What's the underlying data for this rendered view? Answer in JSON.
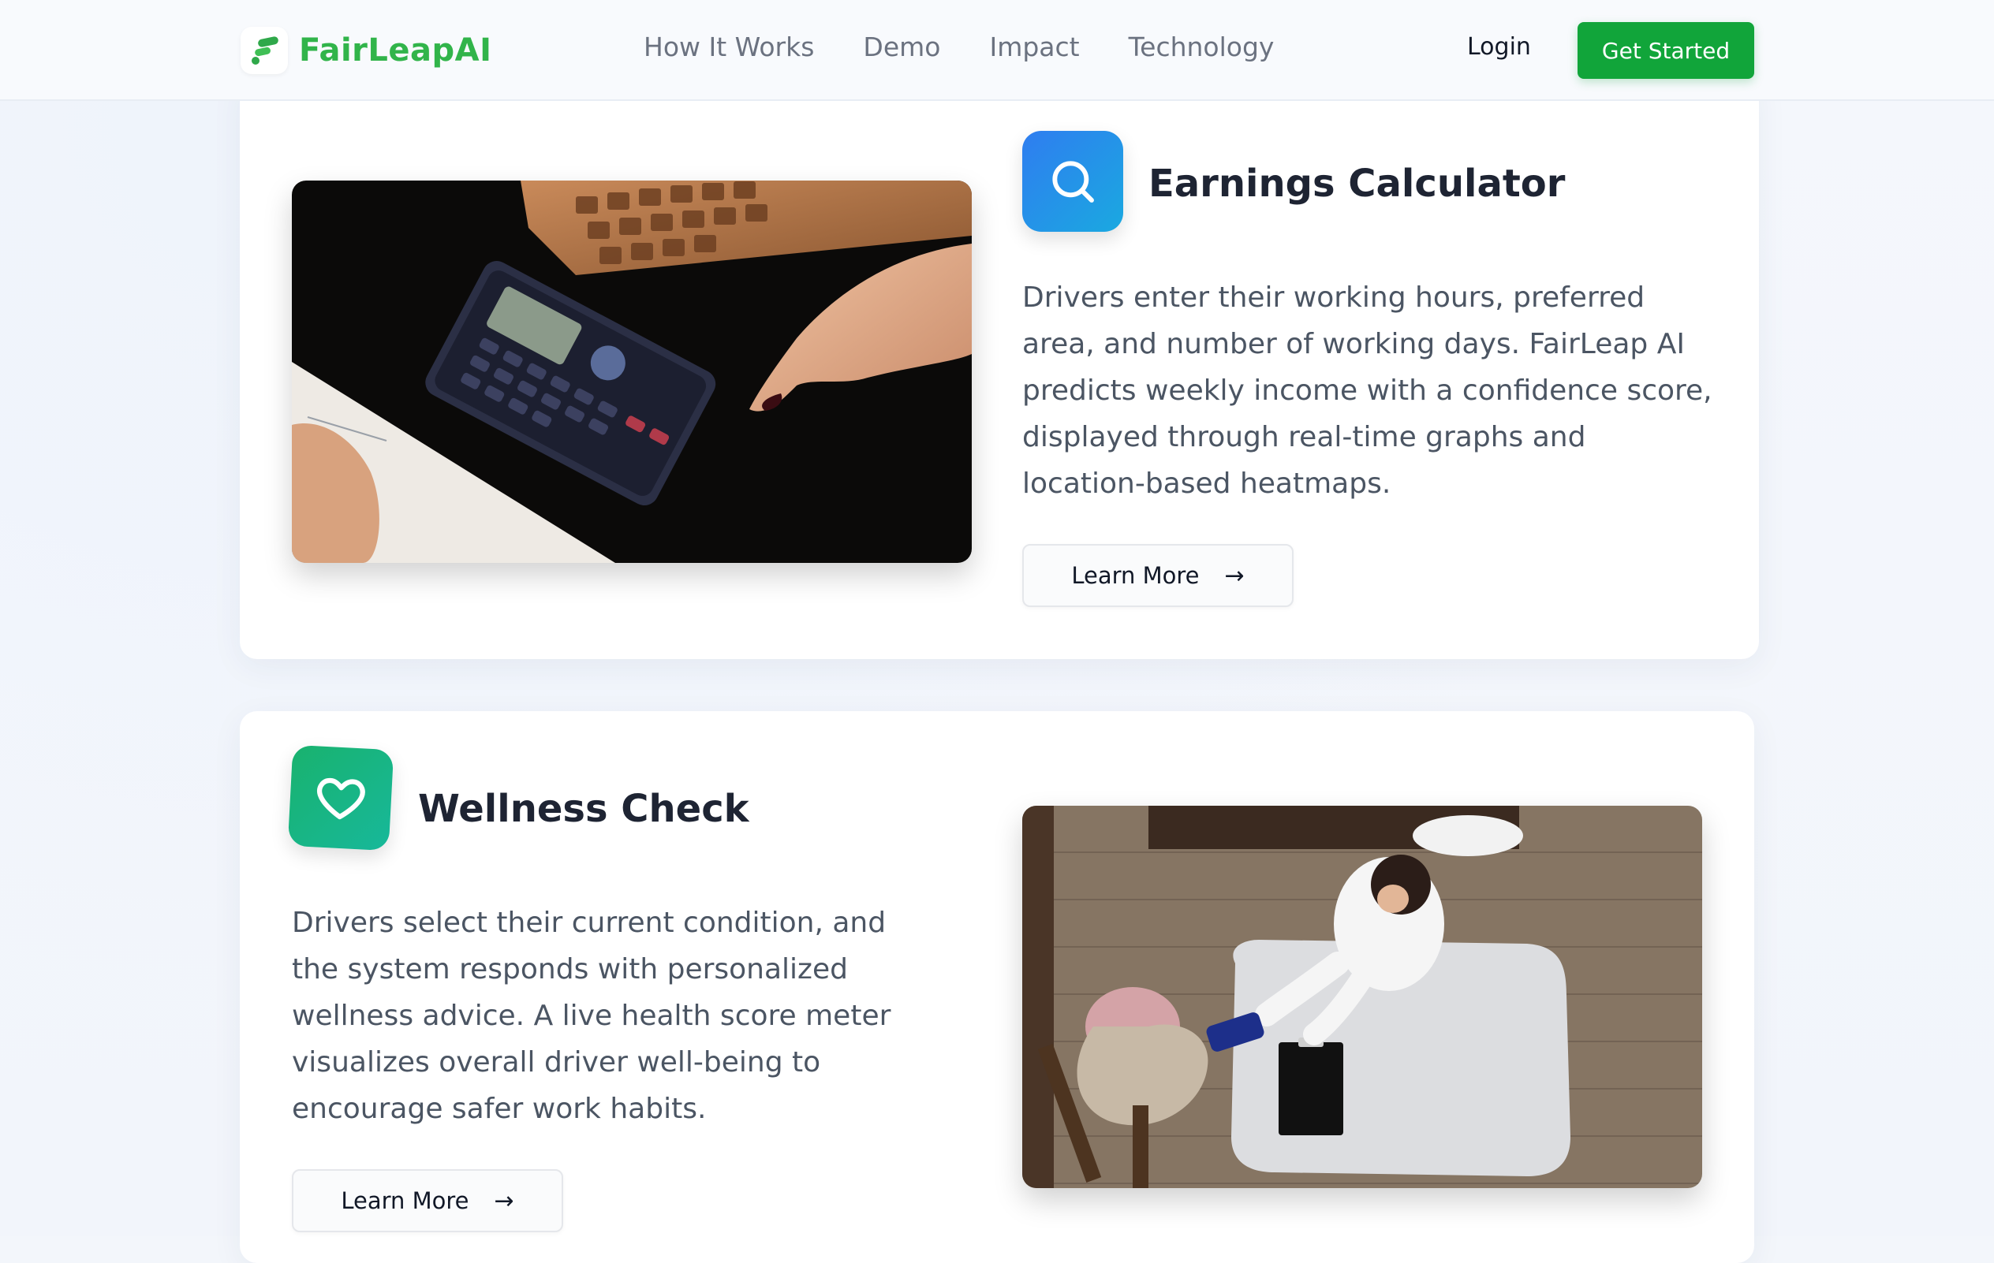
{
  "brand": {
    "name": "FairLeapAI",
    "color": "#31b44a"
  },
  "nav": {
    "links": [
      "How It Works",
      "Demo",
      "Impact",
      "Technology"
    ],
    "login_label": "Login",
    "cta_label": "Get Started",
    "cta_color": "#11a53a"
  },
  "features": [
    {
      "title": "Earnings Calculator",
      "icon": "search-icon",
      "icon_color": "#2f7df0",
      "description": "Drivers enter their working hours, preferred area, and number of working days. FairLeap AI predicts weekly income with a confidence score, displayed through real-time graphs and location-based heatmaps.",
      "button_label": "Learn More",
      "button_arrow": "→",
      "image": "photo of hand using calculator beside wooden keyboard"
    },
    {
      "title": "Wellness Check",
      "icon": "heart-icon",
      "icon_color": "#19b26e",
      "description": "Drivers select their current condition, and the system responds with personalized wellness advice. A live health score meter visualizes overall driver well-being to encourage safer work habits.",
      "button_label": "Learn More",
      "button_arrow": "→",
      "image": "overhead photo of doctor measuring patient blood pressure at white table"
    }
  ]
}
